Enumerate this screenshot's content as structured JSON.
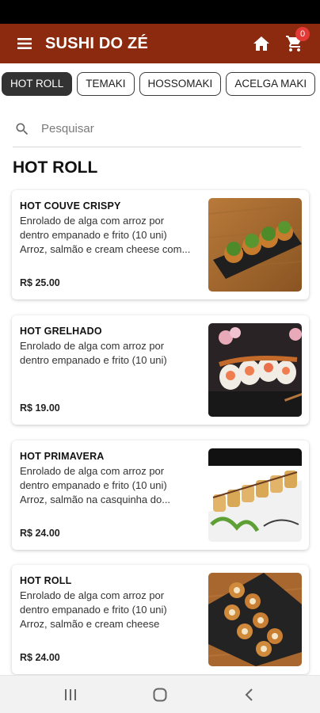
{
  "app": {
    "title": "SUSHI DO ZÉ",
    "bar_color": "#8b2a0e",
    "cart_count": "0"
  },
  "categories": [
    {
      "label": "HOT ROLL",
      "active": true
    },
    {
      "label": "TEMAKI",
      "active": false
    },
    {
      "label": "HOSSOMAKI",
      "active": false
    },
    {
      "label": "ACELGA MAKI",
      "active": false
    }
  ],
  "search": {
    "placeholder": "Pesquisar",
    "value": ""
  },
  "section": {
    "title": "HOT ROLL"
  },
  "products": [
    {
      "name": "HOT COUVE CRISPY",
      "description_lines": [
        "Enrolado de alga com arroz por",
        "dentro empanado e frito (10 uni)",
        "Arroz, salmão e cream cheese com..."
      ],
      "price": "R$ 25.00",
      "image_icon": "fried-sushi-rolls-with-crispy-kale-photo"
    },
    {
      "name": "HOT GRELHADO",
      "description_lines": [
        "Enrolado de alga com arroz por",
        "dentro empanado e frito (10 uni)"
      ],
      "price": "R$ 19.00",
      "image_icon": "grilled-sushi-rolls-photo"
    },
    {
      "name": "HOT PRIMAVERA",
      "description_lines": [
        "Enrolado de alga com arroz por",
        "dentro empanado e frito (10 uni)",
        "Arroz, salmão na casquinha do..."
      ],
      "price": "R$ 24.00",
      "image_icon": "spring-roll-sushi-platter-photo"
    },
    {
      "name": "HOT ROLL",
      "description_lines": [
        "Enrolado de alga com arroz por",
        "dentro empanado e frito (10 uni)",
        "Arroz, salmão e cream cheese"
      ],
      "price": "R$ 24.00",
      "image_icon": "hot-roll-sushi-photo"
    }
  ],
  "icons": {
    "menu": "menu-icon",
    "home": "home-icon",
    "cart": "shopping-cart-icon",
    "search": "search-icon",
    "nav_recent": "recent-apps-icon",
    "nav_home": "nav-home-icon",
    "nav_back": "back-icon"
  }
}
